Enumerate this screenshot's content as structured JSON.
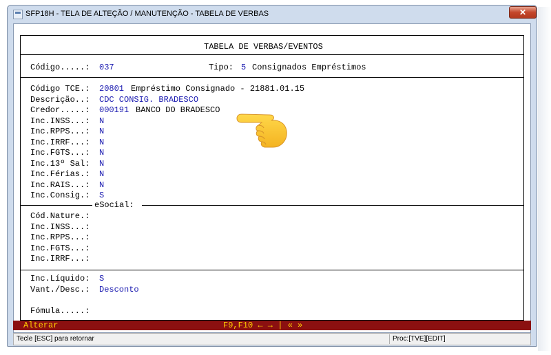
{
  "window": {
    "title": "SFP18H - TELA DE ALTEÇÃO / MANUTENÇÃO - TABELA DE VERBAS",
    "close_label": "✕"
  },
  "screen": {
    "header": "TABELA DE VERBAS/EVENTOS",
    "codigo_label": "Código.....:",
    "codigo_value": "037",
    "tipo_label": "Tipo:",
    "tipo_value": "5 Consignados Empréstimos",
    "codigo_tce_label": "Código TCE.:",
    "codigo_tce_value": "20801",
    "codigo_tce_desc": "Empréstimo Consignado - 21881.01.15",
    "descricao_label": "Descrição..:",
    "descricao_value": "CDC CONSIG. BRADESCO",
    "credor_label": "Credor.....:",
    "credor_value": "000191",
    "credor_desc": "BANCO DO BRADESCO",
    "incidences": [
      {
        "label": "Inc.INSS...:",
        "value": "N"
      },
      {
        "label": "Inc.RPPS...:",
        "value": "N"
      },
      {
        "label": "Inc.IRRF...:",
        "value": "N"
      },
      {
        "label": "Inc.FGTS...:",
        "value": "N"
      },
      {
        "label": "Inc.13º Sal:",
        "value": "N"
      },
      {
        "label": "Inc.Férias.:",
        "value": "N"
      },
      {
        "label": "Inc.RAIS...:",
        "value": "N"
      },
      {
        "label": "Inc.Consig.:",
        "value": "S"
      }
    ],
    "esocial_title": "eSocial:",
    "esocial_fields": [
      {
        "label": "Cód.Nature.:",
        "value": ""
      },
      {
        "label": "Inc.INSS...:",
        "value": ""
      },
      {
        "label": "Inc.RPPS...:",
        "value": ""
      },
      {
        "label": "Inc.FGTS...:",
        "value": ""
      },
      {
        "label": "Inc.IRRF...:",
        "value": ""
      }
    ],
    "inc_liquido_label": "Inc.Líquido:",
    "inc_liquido_value": "S",
    "vant_desc_label": "Vant./Desc.:",
    "vant_desc_value": "Desconto",
    "formula_label": "Fómula.....:",
    "formula_value": ""
  },
  "action_bar": {
    "mode": "Alterar",
    "keys": "F9,F10 ← → | « »"
  },
  "statusbar": {
    "hint": "Tecle [ESC] para retornar",
    "proc": "Proc:[TVE][EDIT]"
  },
  "icons": {
    "pointer": "pointing-hand-emoji"
  },
  "colors": {
    "value_text": "#1a1ab0",
    "action_bar_bg": "#8b1010",
    "action_bar_text": "#ffd000"
  }
}
